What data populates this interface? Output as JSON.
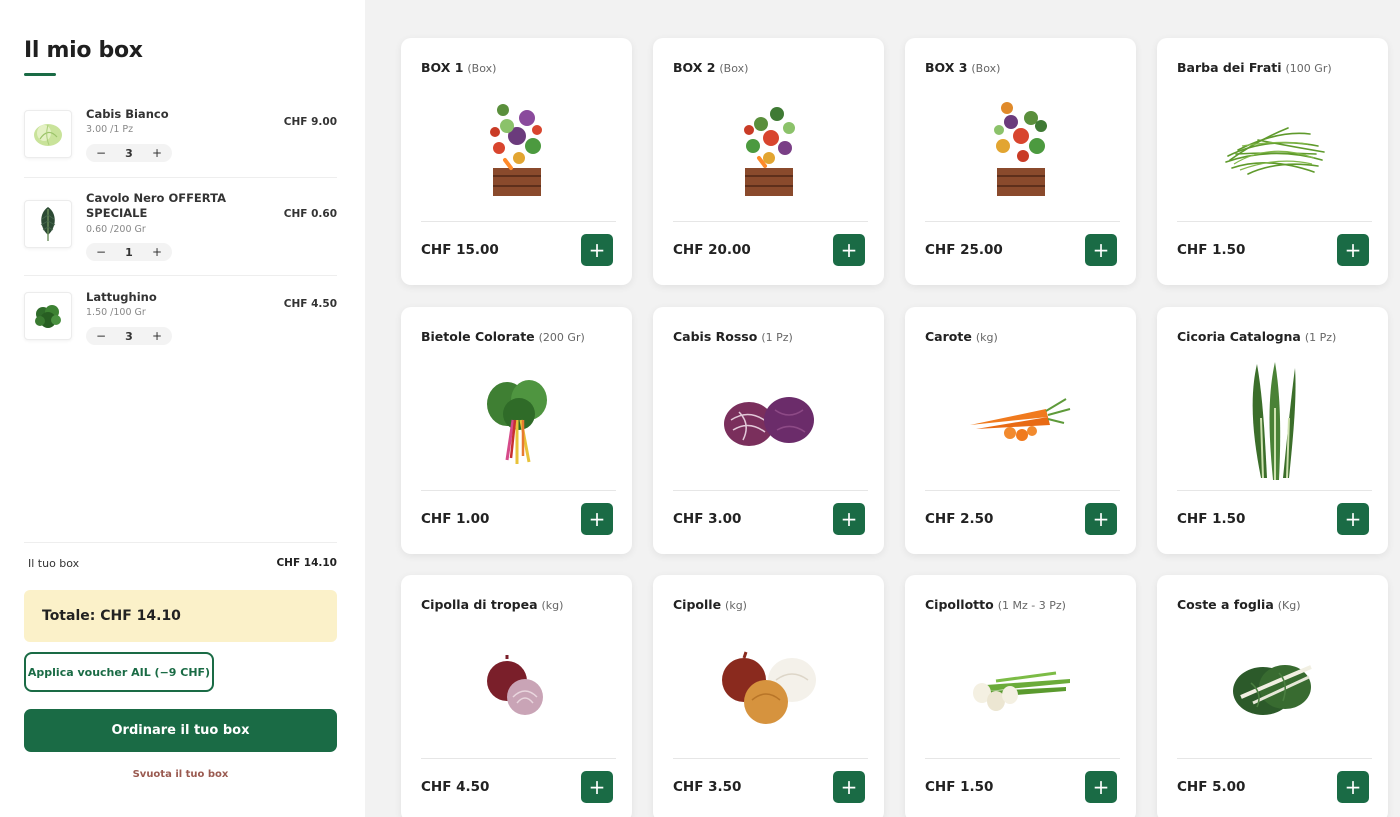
{
  "cart": {
    "title": "Il mio box",
    "items": [
      {
        "name": "Cabis Bianco",
        "unit": "3.00 /1 Pz",
        "qty": "3",
        "price": "CHF 9.00",
        "icon": "white-cabbage-icon"
      },
      {
        "name": "Cavolo Nero OFFERTA SPECIALE",
        "unit": "0.60 /200 Gr",
        "qty": "1",
        "price": "CHF 0.60",
        "icon": "black-kale-icon"
      },
      {
        "name": "Lattughino",
        "unit": "1.50 /100 Gr",
        "qty": "3",
        "price": "CHF 4.50",
        "icon": "lettuce-icon"
      }
    ],
    "minus": "−",
    "plus": "+",
    "subtotal_label": "Il tuo box",
    "subtotal_value": "CHF 14.10",
    "total": "Totale: CHF 14.10",
    "voucher": "Applica voucher AIL (−9 CHF)",
    "order": "Ordinare il tuo box",
    "empty": "Svuota il tuo box"
  },
  "products": [
    {
      "name": "BOX 1",
      "unit": "(Box)",
      "price": "CHF 15.00",
      "icon": "vegetable-box-icon"
    },
    {
      "name": "BOX 2",
      "unit": "(Box)",
      "price": "CHF 20.00",
      "icon": "vegetable-box-icon"
    },
    {
      "name": "BOX 3",
      "unit": "(Box)",
      "price": "CHF 25.00",
      "icon": "vegetable-box-icon"
    },
    {
      "name": "Barba dei Frati",
      "unit": "(100 Gr)",
      "price": "CHF 1.50",
      "icon": "agretti-icon"
    },
    {
      "name": "Bietole Colorate",
      "unit": "(200 Gr)",
      "price": "CHF 1.00",
      "icon": "chard-icon"
    },
    {
      "name": "Cabis Rosso",
      "unit": "(1 Pz)",
      "price": "CHF 3.00",
      "icon": "red-cabbage-icon"
    },
    {
      "name": "Carote",
      "unit": "(kg)",
      "price": "CHF 2.50",
      "icon": "carrot-icon"
    },
    {
      "name": "Cicoria Catalogna",
      "unit": "(1 Pz)",
      "price": "CHF 1.50",
      "icon": "chicory-icon"
    },
    {
      "name": "Cipolla di tropea",
      "unit": "(kg)",
      "price": "CHF 4.50",
      "icon": "red-onion-icon"
    },
    {
      "name": "Cipolle",
      "unit": "(kg)",
      "price": "CHF 3.50",
      "icon": "onions-icon"
    },
    {
      "name": "Cipollotto",
      "unit": "(1 Mz - 3 Pz)",
      "price": "CHF 1.50",
      "icon": "spring-onion-icon"
    },
    {
      "name": "Coste a foglia",
      "unit": "(Kg)",
      "price": "CHF 5.00",
      "icon": "leaf-chard-icon"
    }
  ],
  "add_label": "+",
  "colors": {
    "accent": "#1a6b45",
    "total_bg": "#fbf1c9",
    "empty_link": "#9a5a50"
  }
}
